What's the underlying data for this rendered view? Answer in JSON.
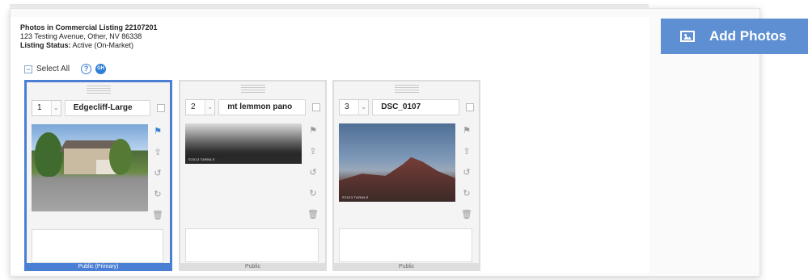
{
  "header": {
    "title": "Photos in Commercial Listing 22107201",
    "address": "123 Testing Avenue, Other, NV 86338",
    "status_label": "Listing Status:",
    "status_value": "Active (On-Market)"
  },
  "toolbar": {
    "select_all_label": "Select All",
    "select_all_symbol": "−",
    "help_symbol": "?",
    "gh_label": "GH"
  },
  "add_photos": {
    "label": "Add Photos",
    "icon": "image-icon",
    "color": "#5d8fd2"
  },
  "photos": [
    {
      "order": "1",
      "name": "Edgecliff-Large",
      "visibility": "Public (Primary)",
      "watermark": "",
      "flagged": true
    },
    {
      "order": "2",
      "name": "mt lemmon pano",
      "visibility": "Public",
      "watermark": "©2013 TARMLS",
      "flagged": false
    },
    {
      "order": "3",
      "name": "DSC_0107",
      "visibility": "Public",
      "watermark": "©2013 TARMLS",
      "flagged": false
    }
  ],
  "tools": {
    "flag": "⚑",
    "upload": "⇪",
    "rotate_left": "↺",
    "rotate_right": "↻",
    "delete": "🗑"
  },
  "colors": {
    "primary_border": "#4a7fd4",
    "accent": "#3b7fd1"
  }
}
